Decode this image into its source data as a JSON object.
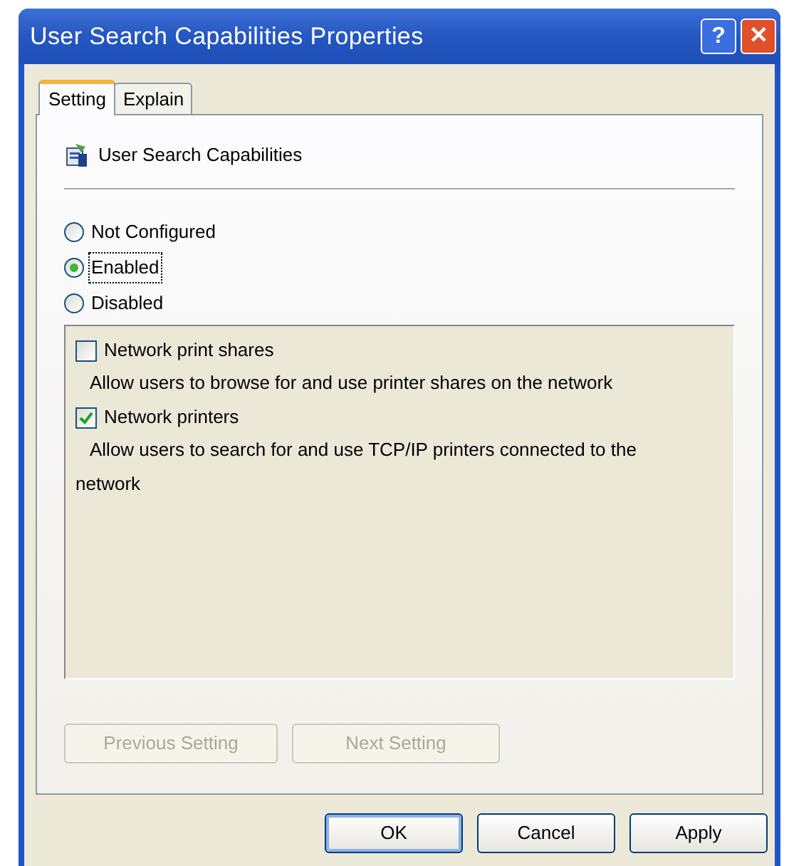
{
  "window": {
    "title": "User Search Capabilities Properties",
    "title_buttons": [
      {
        "kind": "help",
        "label": "?"
      },
      {
        "kind": "close",
        "label": "✕"
      }
    ]
  },
  "tabs": [
    {
      "label": "Setting",
      "selected": true
    },
    {
      "label": "Explain",
      "selected": false
    }
  ],
  "policy": {
    "name": "User Search Capabilities"
  },
  "options": [
    {
      "label": "Not Configured",
      "selected": false,
      "focused": false
    },
    {
      "label": "Enabled",
      "selected": true,
      "focused": true
    },
    {
      "label": "Disabled",
      "selected": false,
      "focused": false
    }
  ],
  "settings": [
    {
      "label": "Network print shares",
      "checked": false,
      "description": "Allow users to browse for and use printer shares on the network"
    },
    {
      "label": "Network printers",
      "checked": true,
      "description": "Allow users to search for and use TCP/IP printers connected to the network"
    }
  ],
  "nav_buttons": [
    {
      "label": "Previous Setting",
      "disabled": true
    },
    {
      "label": "Next Setting",
      "disabled": true
    }
  ],
  "buttons": [
    {
      "label": "OK",
      "default": true
    },
    {
      "label": "Cancel",
      "default": false
    },
    {
      "label": "Apply",
      "default": false
    }
  ]
}
